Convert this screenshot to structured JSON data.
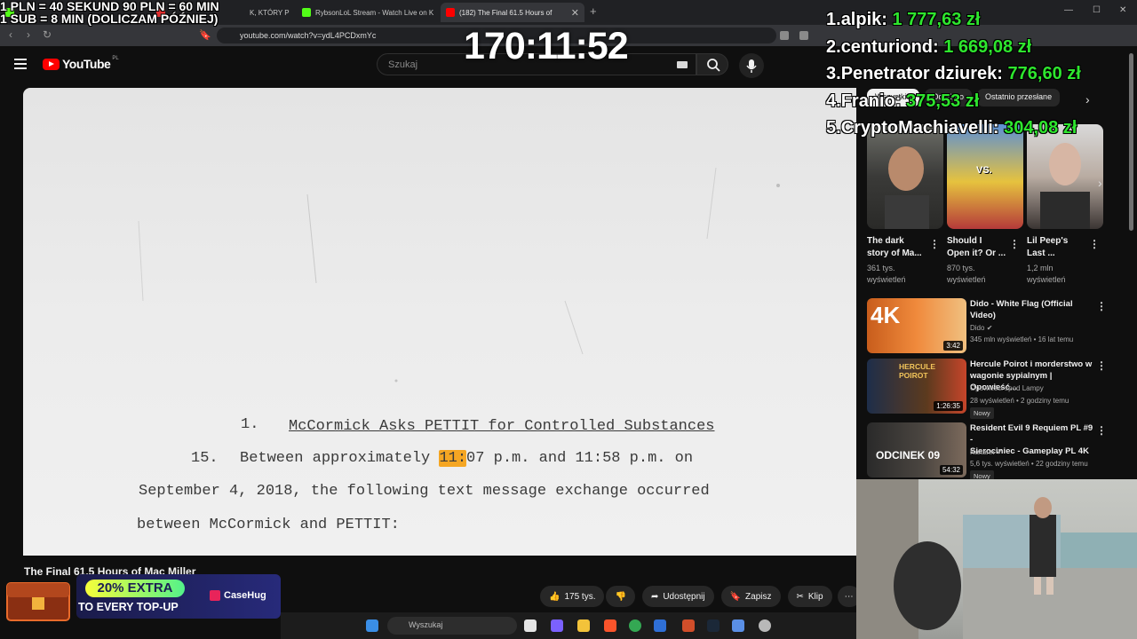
{
  "browser": {
    "tabs": [
      {
        "label": "",
        "active": false
      },
      {
        "label": "K, KTÓRY PO",
        "active": false
      },
      {
        "label": "RybsonLoL Stream - Watch Live on K",
        "active": false
      },
      {
        "label": "(182) The Final 61.5 Hours of",
        "active": true
      }
    ],
    "url": "youtube.com/watch?v=ydL4PCDxmYc"
  },
  "youtube": {
    "logo_text": "YouTube",
    "region": "PL",
    "search_placeholder": "Szukaj",
    "video_title": "The Final 61.5 Hours of Mac Miller",
    "likes": "175 tys.",
    "share_label": "Udostępnij",
    "save_label": "Zapisz",
    "clip_label": "Klip"
  },
  "document": {
    "heading_number": "1.",
    "heading_text": "McCormick Asks PETTIT for Controlled Substances",
    "para_number": "15.",
    "line1_pre": "Between approximately ",
    "line1_highlight": "11:",
    "line1_post": "07 p.m. and 11:58 p.m. on",
    "line2": "September 4, 2018, the following text message exchange occurred",
    "line3": "between McCormick and PETTIT:"
  },
  "overlay": {
    "timer": "170:11:52",
    "promo_line1": "1 PLN = 40 SEKUND 90 PLN = 60 MIN",
    "promo_line2": "1 SUB = 8 MIN (DOLICZAM PÓŹNIEJ)",
    "leaderboard": [
      {
        "rank": "1.",
        "name": "alpik:",
        "amount": "1 777,63 zł"
      },
      {
        "rank": "2.",
        "name": "centuriond:",
        "amount": "1 669,08 zł"
      },
      {
        "rank": "3.",
        "name": "Penetrator dziurek:",
        "amount": "776,60 zł"
      },
      {
        "rank": "4.",
        "name": "Franio:",
        "amount": "375,53 zł"
      },
      {
        "rank": "5.",
        "name": "CryptoMachiavelli:",
        "amount": "304,08 zł"
      }
    ]
  },
  "sidebar": {
    "chips": [
      "Wszystkie",
      "Od: Dido",
      "Ostatnio przesłane"
    ],
    "shorts": [
      {
        "title_line1": "The dark",
        "title_line2": "story of Ma...",
        "meta_line1": "361 tys.",
        "meta_line2": "wyświetleń"
      },
      {
        "title_line1": "Should I",
        "title_line2": "Open it? Or ...",
        "meta_line1": "870 tys.",
        "meta_line2": "wyświetleń"
      },
      {
        "title_line1": "Lil Peep's",
        "title_line2": "Last ...",
        "meta_line1": "1,2 mln",
        "meta_line2": "wyświetleń"
      }
    ],
    "shorts_thumb_vs": "VS.",
    "videos": [
      {
        "title_line1": "Dido - White Flag (Official",
        "title_line2": "Video)",
        "channel": "Dido",
        "meta": "345 mln wyświetleń • 16 lat temu",
        "duration": "3:42",
        "badge": "",
        "thumb_text": "4K"
      },
      {
        "title_line1": "Hercule Poirot i morderstwo w",
        "title_line2": "wagonie sypialnym | Opowieść...",
        "channel": "Opowieści spod Lampy",
        "meta": "28 wyświetleń • 2 godziny temu",
        "duration": "1:26:35",
        "badge": "Nowy",
        "thumb_text": "HERCULE POIROT"
      },
      {
        "title_line1": "Resident Evil 9 Requiem PL #9 -",
        "title_line2": "Sierociniec - Gameplay PL 4K",
        "channel": "Kaftann",
        "meta": "5,6 tys. wyświetleń • 22 godziny temu",
        "duration": "54:32",
        "badge": "Nowy",
        "thumb_text": "ODCINEK 09"
      }
    ]
  },
  "taskbar": {
    "search_placeholder": "Wyszukaj"
  },
  "ad": {
    "pill_text": "20% EXTRA",
    "sub_text": "TO EVERY TOP-UP",
    "brand": "CaseHug"
  }
}
